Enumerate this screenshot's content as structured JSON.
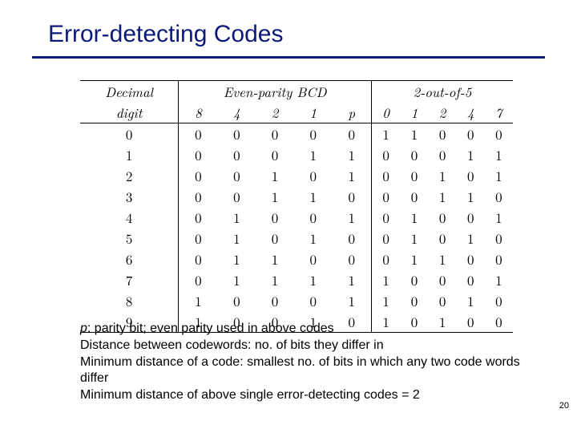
{
  "title": "Error-detecting Codes",
  "chart_data": {
    "type": "table",
    "title": "Error-detecting Codes",
    "group_headers": [
      "Decimal",
      "Even-parity BCD",
      "2-out-of-5"
    ],
    "sub_headers": {
      "decimal": "digit",
      "bcd": [
        "8",
        "4",
        "2",
        "1",
        "p"
      ],
      "two_of_five": [
        "0",
        "1",
        "2",
        "4",
        "7"
      ]
    },
    "rows": [
      {
        "d": "0",
        "bcd": [
          "0",
          "0",
          "0",
          "0",
          "0"
        ],
        "t": [
          "1",
          "1",
          "0",
          "0",
          "0"
        ]
      },
      {
        "d": "1",
        "bcd": [
          "0",
          "0",
          "0",
          "1",
          "1"
        ],
        "t": [
          "0",
          "0",
          "0",
          "1",
          "1"
        ]
      },
      {
        "d": "2",
        "bcd": [
          "0",
          "0",
          "1",
          "0",
          "1"
        ],
        "t": [
          "0",
          "0",
          "1",
          "0",
          "1"
        ]
      },
      {
        "d": "3",
        "bcd": [
          "0",
          "0",
          "1",
          "1",
          "0"
        ],
        "t": [
          "0",
          "0",
          "1",
          "1",
          "0"
        ]
      },
      {
        "d": "4",
        "bcd": [
          "0",
          "1",
          "0",
          "0",
          "1"
        ],
        "t": [
          "0",
          "1",
          "0",
          "0",
          "1"
        ]
      },
      {
        "d": "5",
        "bcd": [
          "0",
          "1",
          "0",
          "1",
          "0"
        ],
        "t": [
          "0",
          "1",
          "0",
          "1",
          "0"
        ]
      },
      {
        "d": "6",
        "bcd": [
          "0",
          "1",
          "1",
          "0",
          "0"
        ],
        "t": [
          "0",
          "1",
          "1",
          "0",
          "0"
        ]
      },
      {
        "d": "7",
        "bcd": [
          "0",
          "1",
          "1",
          "1",
          "1"
        ],
        "t": [
          "1",
          "0",
          "0",
          "0",
          "1"
        ]
      },
      {
        "d": "8",
        "bcd": [
          "1",
          "0",
          "0",
          "0",
          "1"
        ],
        "t": [
          "1",
          "0",
          "0",
          "1",
          "0"
        ]
      },
      {
        "d": "9",
        "bcd": [
          "1",
          "0",
          "0",
          "1",
          "0"
        ],
        "t": [
          "1",
          "0",
          "1",
          "0",
          "0"
        ]
      }
    ]
  },
  "notes": {
    "p_italic": "p",
    "line1_rest": ": parity bit; even parity used in above codes",
    "line2": "Distance between codewords: no. of bits they differ in",
    "line3": "Minimum distance of a code: smallest no. of bits in which any two code words differ",
    "line4": "Minimum distance of above single error-detecting codes = 2"
  },
  "page_number": "20"
}
